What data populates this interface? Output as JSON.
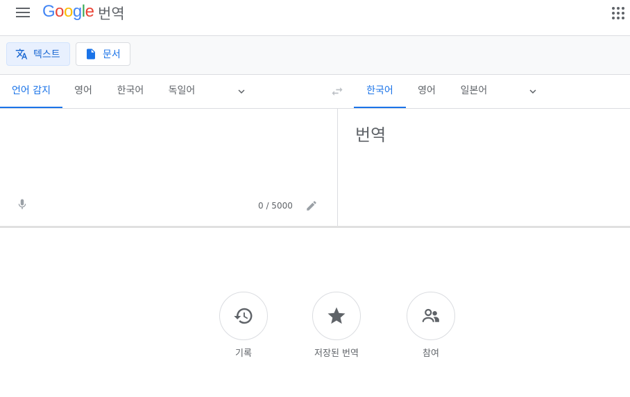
{
  "header": {
    "logo_letters": [
      "G",
      "o",
      "o",
      "g",
      "l",
      "e"
    ],
    "product_name": "번역"
  },
  "modes": {
    "text_label": "텍스트",
    "document_label": "문서"
  },
  "source_langs": [
    "언어 감지",
    "영어",
    "한국어",
    "독일어"
  ],
  "target_langs": [
    "한국어",
    "영어",
    "일본어"
  ],
  "source_panel": {
    "char_count": "0 / 5000"
  },
  "target_panel": {
    "placeholder": "번역"
  },
  "actions": {
    "history_label": "기록",
    "saved_label": "저장된 번역",
    "community_label": "참여"
  },
  "colors": {
    "accent": "#1a73e8",
    "icon_gray": "#5f6368",
    "logo": [
      "#4285f4",
      "#ea4335",
      "#fbbc05",
      "#4285f4",
      "#34a853",
      "#ea4335"
    ]
  }
}
